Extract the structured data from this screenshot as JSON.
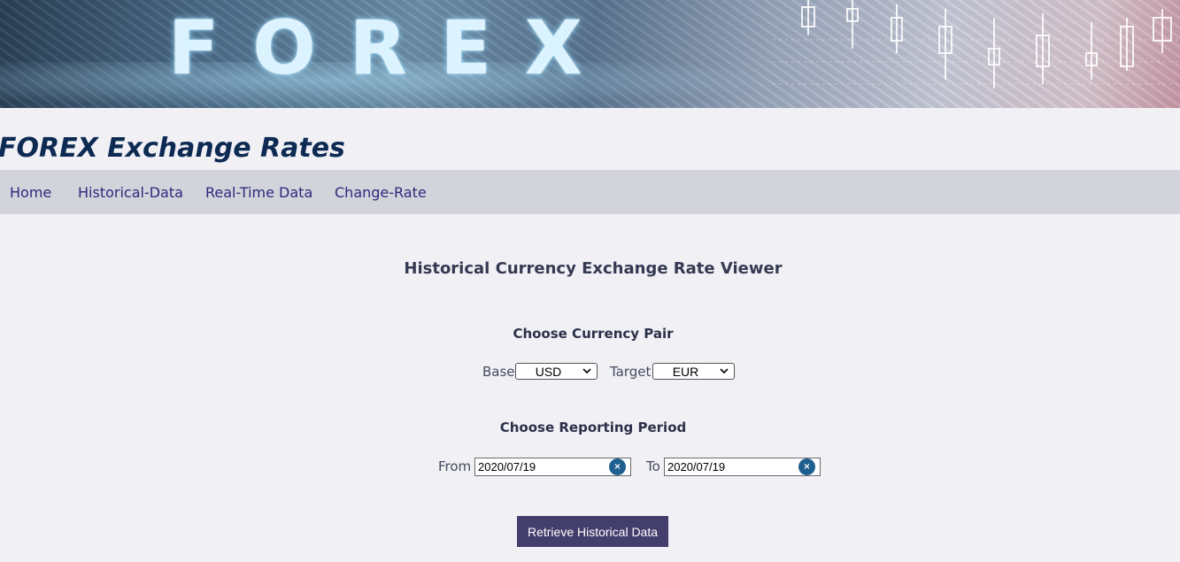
{
  "banner": {
    "word": "FOREX"
  },
  "header": {
    "title": "FOREX Exchange Rates"
  },
  "nav": {
    "items": [
      {
        "label": "Home"
      },
      {
        "label": "Historical-Data"
      },
      {
        "label": "Real-Time Data"
      },
      {
        "label": "Change-Rate"
      }
    ]
  },
  "main": {
    "title": "Historical Currency Exchange Rate Viewer",
    "currency_section": {
      "heading": "Choose Currency Pair",
      "base_label": "Base",
      "base_value": "USD",
      "target_label": "Target",
      "target_value": "EUR"
    },
    "period_section": {
      "heading": "Choose Reporting Period",
      "from_label": "From",
      "from_value": "2020/07/19",
      "to_label": "To",
      "to_value": "2020/07/19",
      "clear_glyph": "×"
    },
    "retrieve_button": "Retrieve Historical Data"
  },
  "colors": {
    "page_bg": "#f0f0f5",
    "nav_bg": "#d3d3dc",
    "title_color": "#0d2a52",
    "link_color": "#2a2a7c",
    "button_bg": "#433e6c",
    "clear_button_bg": "#1f5f8f"
  }
}
